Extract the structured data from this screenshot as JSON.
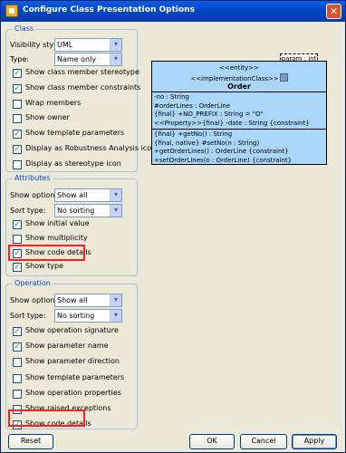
{
  "window": {
    "title": "Configure Class Presentation Options",
    "close_glyph": "✕"
  },
  "class_group": {
    "title": "Class",
    "visibility_label": "Visibility style:",
    "visibility_value": "UML",
    "type_label": "Type:",
    "type_value": "Name only",
    "options": [
      {
        "label": "Show class member stereotype",
        "checked": true
      },
      {
        "label": "Show class member constraints",
        "checked": true
      },
      {
        "label": "Wrap members",
        "checked": false
      },
      {
        "label": "Show owner",
        "checked": false
      },
      {
        "label": "Show template parameters",
        "checked": true
      },
      {
        "label": "Display as Robustness Analysis icon",
        "checked": true
      },
      {
        "label": "Display as stereotype icon",
        "checked": false
      }
    ]
  },
  "attributes_group": {
    "title": "Attributes",
    "show_option_label": "Show option:",
    "show_option_value": "Show all",
    "sort_type_label": "Sort type:",
    "sort_type_value": "No sorting",
    "options": [
      {
        "label": "Show initial value",
        "checked": true
      },
      {
        "label": "Show multiplicity",
        "checked": false
      },
      {
        "label": "Show code details",
        "checked": true
      },
      {
        "label": "Show type",
        "checked": true
      }
    ]
  },
  "operation_group": {
    "title": "Operation",
    "show_option_label": "Show option:",
    "show_option_value": "Show all",
    "sort_type_label": "Sort type:",
    "sort_type_value": "No sorting",
    "options": [
      {
        "label": "Show operation signature",
        "checked": true
      },
      {
        "label": "Show parameter name",
        "checked": true
      },
      {
        "label": "Show parameter direction",
        "checked": false
      },
      {
        "label": "Show template parameters",
        "checked": false
      },
      {
        "label": "Show operation properties",
        "checked": false
      },
      {
        "label": "Show raised exceptions",
        "checked": false
      },
      {
        "label": "Show code details",
        "checked": true
      }
    ]
  },
  "preview": {
    "param_tab": "param : int",
    "stereotype_entity": "<<entity>>",
    "stereotype_impl": "<<implementationClass>>",
    "class_name": "Order",
    "attributes": [
      "-no : String",
      "#orderLines : OrderLine",
      "{final} +NO_PREFIX : String = \"O\"",
      "<<Property>>{final} -date : String {constraint}"
    ],
    "operations": [
      "{final} +getNo() : String",
      "{final, native} #setNo(n : String)",
      "+getOrderLines() : OrderLine {constraint}",
      "+setOrderLines(o : OrderLine) {constraint}"
    ]
  },
  "buttons": {
    "reset": "Reset",
    "ok": "OK",
    "cancel": "Cancel",
    "apply": "Apply"
  },
  "icons": {
    "checkmark": "✓",
    "dropdown": "▾"
  },
  "colors": {
    "highlight": "#ff1e1e",
    "uml_fill": "#aad7f9",
    "group_title": "#0046d5"
  }
}
